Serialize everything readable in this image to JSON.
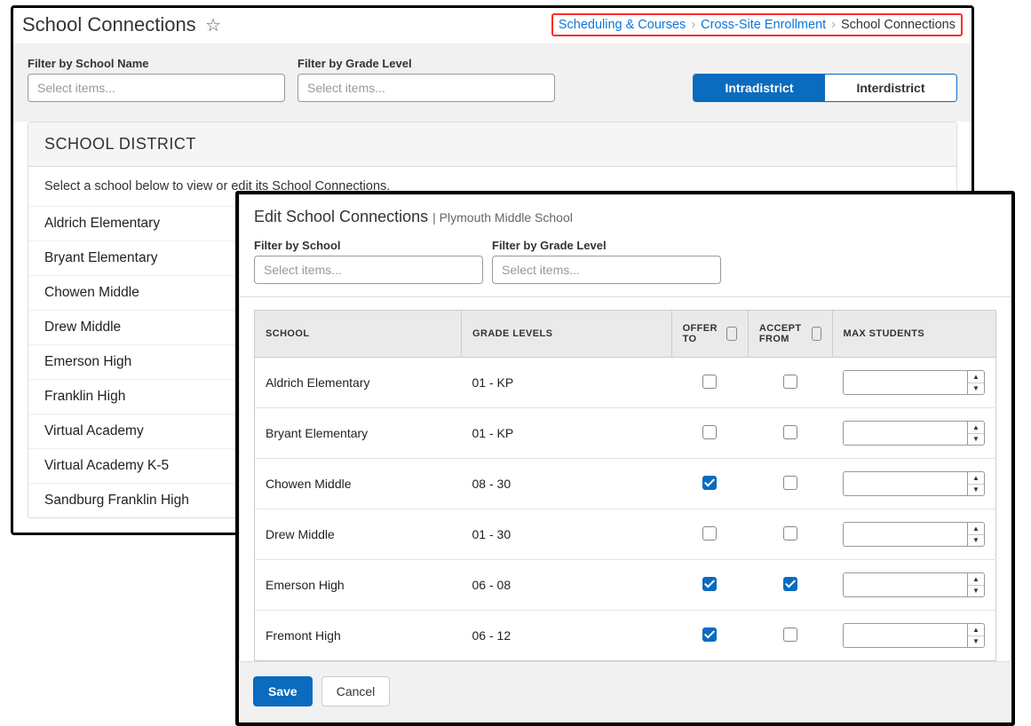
{
  "page": {
    "title": "School Connections"
  },
  "breadcrumb": {
    "item1": "Scheduling & Courses",
    "item2": "Cross-Site Enrollment",
    "item3": "School Connections"
  },
  "filters": {
    "schoolName": {
      "label": "Filter by School Name",
      "placeholder": "Select items..."
    },
    "gradeLevel": {
      "label": "Filter by Grade Level",
      "placeholder": "Select items..."
    }
  },
  "toggle": {
    "intra": "Intradistrict",
    "inter": "Interdistrict"
  },
  "section": {
    "heading": "SCHOOL DISTRICT",
    "instruction": "Select a school below to view or edit its School Connections."
  },
  "schools": [
    "Aldrich Elementary",
    "Bryant Elementary",
    "Chowen Middle",
    "Drew Middle",
    "Emerson High",
    "Franklin High",
    "Virtual Academy",
    "Virtual Academy K-5",
    "Sandburg Franklin High"
  ],
  "overlay": {
    "title": "Edit School Connections",
    "subtitle": "Plymouth Middle School",
    "filters": {
      "school": {
        "label": "Filter by School",
        "placeholder": "Select items..."
      },
      "gradeLevel": {
        "label": "Filter by Grade Level",
        "placeholder": "Select items..."
      }
    },
    "columns": {
      "school": "SCHOOL",
      "gradeLevels": "GRADE LEVELS",
      "offerTo": "OFFER TO",
      "acceptFrom": "ACCEPT FROM",
      "maxStudents": "MAX STUDENTS"
    },
    "rows": [
      {
        "school": "Aldrich Elementary",
        "grade": "01 - KP",
        "offer": false,
        "accept": false
      },
      {
        "school": "Bryant Elementary",
        "grade": "01 - KP",
        "offer": false,
        "accept": false
      },
      {
        "school": "Chowen Middle",
        "grade": "08 - 30",
        "offer": true,
        "accept": false
      },
      {
        "school": "Drew Middle",
        "grade": "01 - 30",
        "offer": false,
        "accept": false
      },
      {
        "school": "Emerson High",
        "grade": "06 - 08",
        "offer": true,
        "accept": true
      },
      {
        "school": "Fremont High",
        "grade": "06 - 12",
        "offer": true,
        "accept": false
      }
    ],
    "buttons": {
      "save": "Save",
      "cancel": "Cancel"
    }
  }
}
